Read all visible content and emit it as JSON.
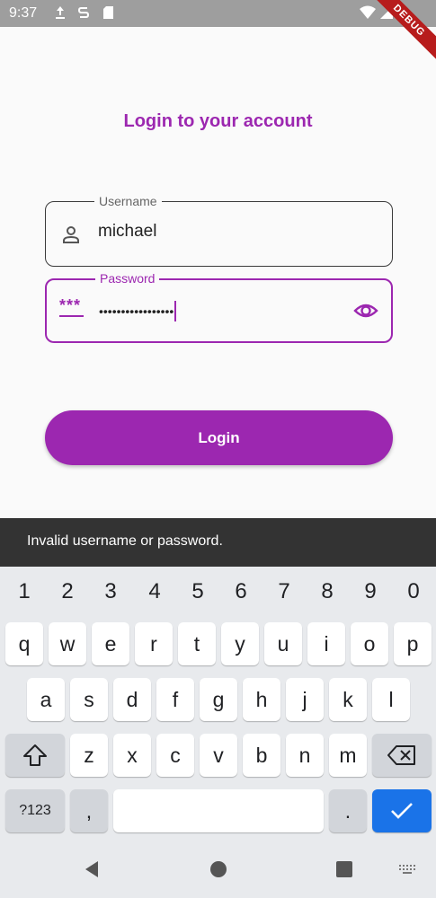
{
  "status_bar": {
    "time": "9:37"
  },
  "debug_banner": "DEBUG",
  "title": "Login to your account",
  "username": {
    "label": "Username",
    "value": "michael"
  },
  "password": {
    "label": "Password",
    "value": "•••••••••••••••••",
    "icon_text": "***"
  },
  "login_button": "Login",
  "snackbar": "Invalid username or password.",
  "keyboard": {
    "numbers": [
      "1",
      "2",
      "3",
      "4",
      "5",
      "6",
      "7",
      "8",
      "9",
      "0"
    ],
    "row1": [
      "q",
      "w",
      "e",
      "r",
      "t",
      "y",
      "u",
      "i",
      "o",
      "p"
    ],
    "row2": [
      "a",
      "s",
      "d",
      "f",
      "g",
      "h",
      "j",
      "k",
      "l"
    ],
    "row3": [
      "z",
      "x",
      "c",
      "v",
      "b",
      "n",
      "m"
    ],
    "symbols_key": "?123",
    "comma_key": ",",
    "period_key": "."
  },
  "colors": {
    "accent": "#9c27b0",
    "snackbar_bg": "#333333",
    "keyboard_bg": "#e8eaed",
    "enter_key": "#1a73e8"
  }
}
